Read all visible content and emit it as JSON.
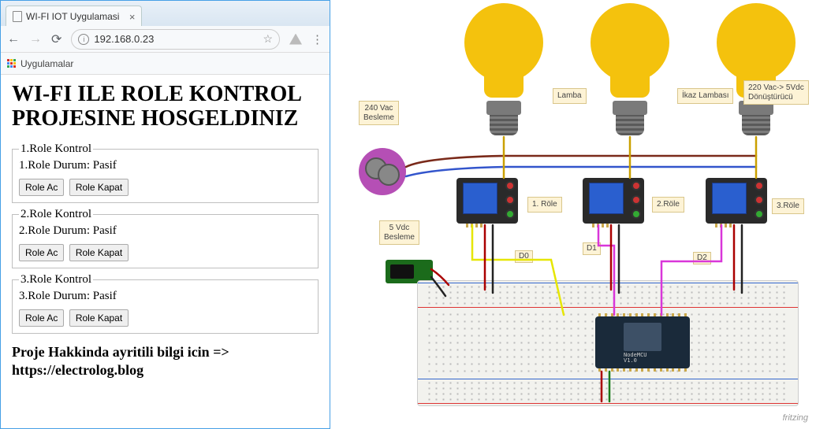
{
  "browser": {
    "tab_title": "WI-FI IOT Uygulamasi",
    "url": "192.168.0.23",
    "bookmarks_label": "Uygulamalar"
  },
  "page": {
    "heading": "WI-FI ILE ROLE KONTROL PROJESINE HOSGELDINIZ",
    "relays": [
      {
        "legend": "1.Role Kontrol",
        "status": "1.Role Durum: Pasif",
        "btn_on": "Role Ac",
        "btn_off": "Role Kapat"
      },
      {
        "legend": "2.Role Kontrol",
        "status": "2.Role Durum: Pasif",
        "btn_on": "Role Ac",
        "btn_off": "Role Kapat"
      },
      {
        "legend": "3.Role Kontrol",
        "status": "3.Role Durum: Pasif",
        "btn_on": "Role Ac",
        "btn_off": "Role Kapat"
      }
    ],
    "footer": "Proje Hakkinda ayritili bilgi icin => https://electrolog.blog"
  },
  "diagram": {
    "notes": {
      "supply240": "240 Vac\nBesleme",
      "lamp": "Lamba",
      "warn_lamp": "İkaz Lambası",
      "converter": "220 Vac-> 5Vdc\nDönüştürücü",
      "relay1": "1. Röle",
      "relay2": "2.Röle",
      "relay3": "3.Röle",
      "supply5": "5 Vdc\nBesleme",
      "d0": "D0",
      "d1": "D1",
      "d2": "D2"
    },
    "nodemcu_label": "NodeMCU\nV1.0",
    "credit": "fritzing"
  }
}
